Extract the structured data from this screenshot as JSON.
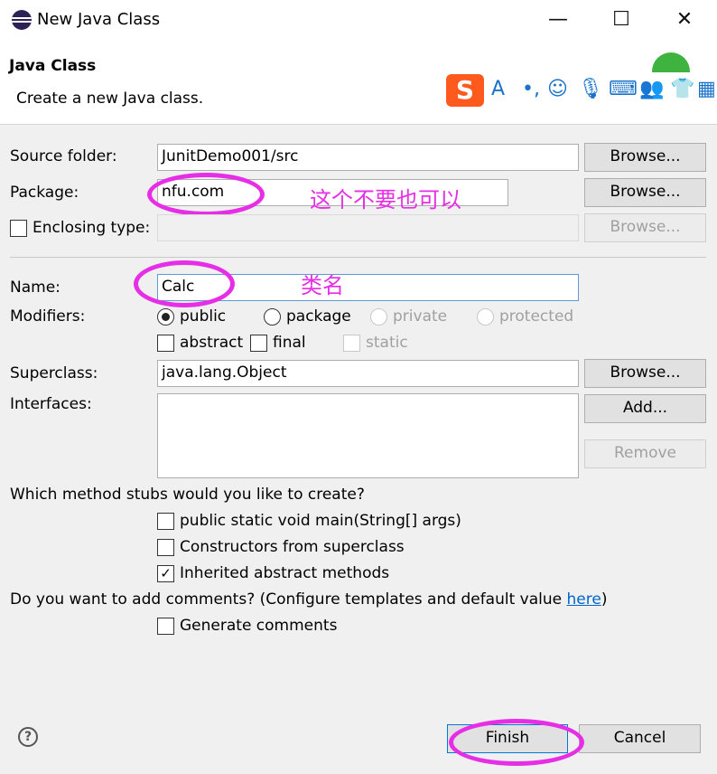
{
  "window": {
    "title": "New Java Class",
    "minimize": "—",
    "maximize": "☐",
    "close": "✕"
  },
  "banner": {
    "title": "Java Class",
    "description": "Create a new Java class."
  },
  "ime": {
    "logo": "S",
    "icons": [
      "A",
      "•,",
      "☺",
      "🎙",
      "⌨",
      "👥",
      "👕",
      "▦"
    ]
  },
  "form": {
    "source_folder": {
      "label": "Source folder:",
      "value": "JunitDemo001/src",
      "button": "Browse..."
    },
    "package": {
      "label": "Package:",
      "value": "nfu.com",
      "button": "Browse..."
    },
    "enclosing": {
      "label": "Enclosing type:",
      "value": "",
      "button": "Browse..."
    },
    "name": {
      "label": "Name:",
      "value": "Calc"
    },
    "modifiers": {
      "label": "Modifiers:",
      "radios": [
        "public",
        "package",
        "private",
        "protected"
      ],
      "checks": [
        "abstract",
        "final",
        "static"
      ]
    },
    "superclass": {
      "label": "Superclass:",
      "value": "java.lang.Object",
      "button": "Browse..."
    },
    "interfaces": {
      "label": "Interfaces:",
      "add": "Add...",
      "remove": "Remove"
    },
    "stubs": {
      "question": "Which method stubs would you like to create?",
      "items": [
        "public static void main(String[] args)",
        "Constructors from superclass",
        "Inherited abstract methods"
      ]
    },
    "comments": {
      "question": "Do you want to add comments? (Configure templates and default value ",
      "link": "here",
      "close_paren": ")",
      "generate": "Generate comments"
    }
  },
  "annotations": {
    "package_note": "这个不要也可以",
    "name_note": "类名"
  },
  "footer": {
    "help": "?",
    "finish": "Finish",
    "cancel": "Cancel"
  },
  "colors": {
    "annotation": "#e62ee6",
    "link": "#0066cc",
    "ime_brand": "#ff5a1e"
  }
}
